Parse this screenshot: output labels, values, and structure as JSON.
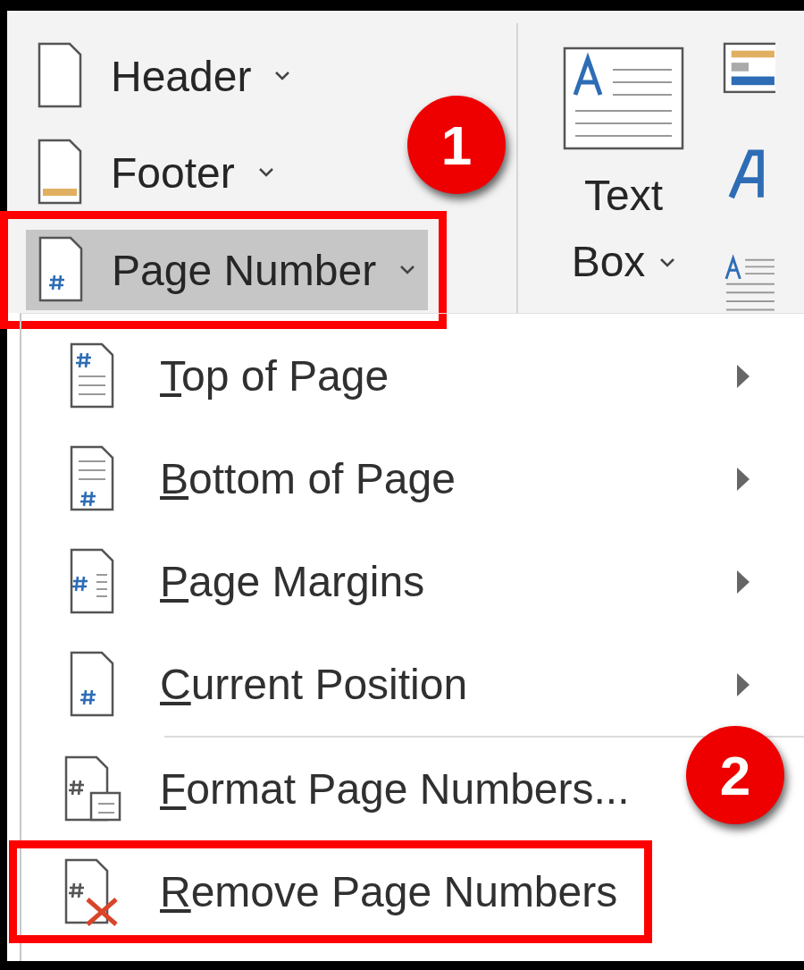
{
  "ribbon": {
    "header_footer_group": [
      {
        "label": "Header",
        "kind": "header",
        "selected": false,
        "highlighted": false
      },
      {
        "label": "Footer",
        "kind": "footer",
        "selected": false,
        "highlighted": false
      },
      {
        "label": "Page Number",
        "kind": "page-number",
        "selected": true,
        "highlighted": true
      }
    ],
    "text_box": {
      "label_lines": [
        "Text",
        "Box"
      ]
    }
  },
  "menu": {
    "items": [
      {
        "label": "Top of Page",
        "kind": "top",
        "submenu": true,
        "separator_before": false,
        "highlighted": false
      },
      {
        "label": "Bottom of Page",
        "kind": "bottom",
        "submenu": true,
        "separator_before": false,
        "highlighted": false
      },
      {
        "label": "Page Margins",
        "kind": "margins",
        "submenu": true,
        "separator_before": false,
        "highlighted": false
      },
      {
        "label": "Current Position",
        "kind": "current",
        "submenu": true,
        "separator_before": false,
        "highlighted": false
      },
      {
        "label": "Format Page Numbers...",
        "kind": "format",
        "submenu": false,
        "separator_before": true,
        "highlighted": false
      },
      {
        "label": "Remove Page Numbers",
        "kind": "remove",
        "submenu": false,
        "separator_before": false,
        "highlighted": true
      }
    ]
  },
  "callouts": [
    {
      "label": "1"
    },
    {
      "label": "2"
    }
  ]
}
